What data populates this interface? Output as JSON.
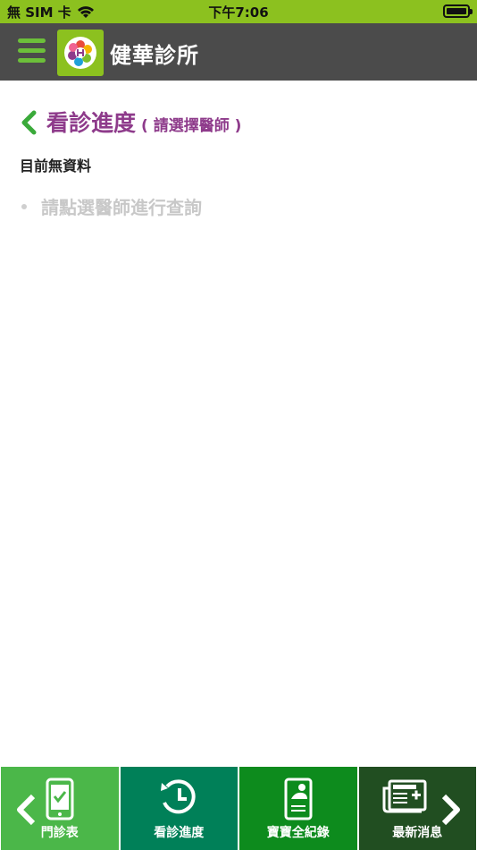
{
  "status_bar": {
    "carrier": "無 SIM 卡",
    "time": "下午7:06"
  },
  "header": {
    "clinic_name": "健華診所"
  },
  "page": {
    "title": "看診進度",
    "subtitle": "( 請選擇醫師 )",
    "no_data": "目前無資料",
    "hint": "請點選醫師進行查詢"
  },
  "bottom_nav": {
    "items": [
      {
        "label": "門診表",
        "color": "#4bb749"
      },
      {
        "label": "看診進度",
        "color": "#008058"
      },
      {
        "label": "寶寶全紀錄",
        "color": "#0d8b1d"
      },
      {
        "label": "最新消息",
        "color": "#214e21"
      }
    ]
  },
  "colors": {
    "status_bar": "#8cc11f",
    "header": "#4b4b4b",
    "title": "#8e3b8b",
    "accent_green": "#6cbf3a"
  }
}
